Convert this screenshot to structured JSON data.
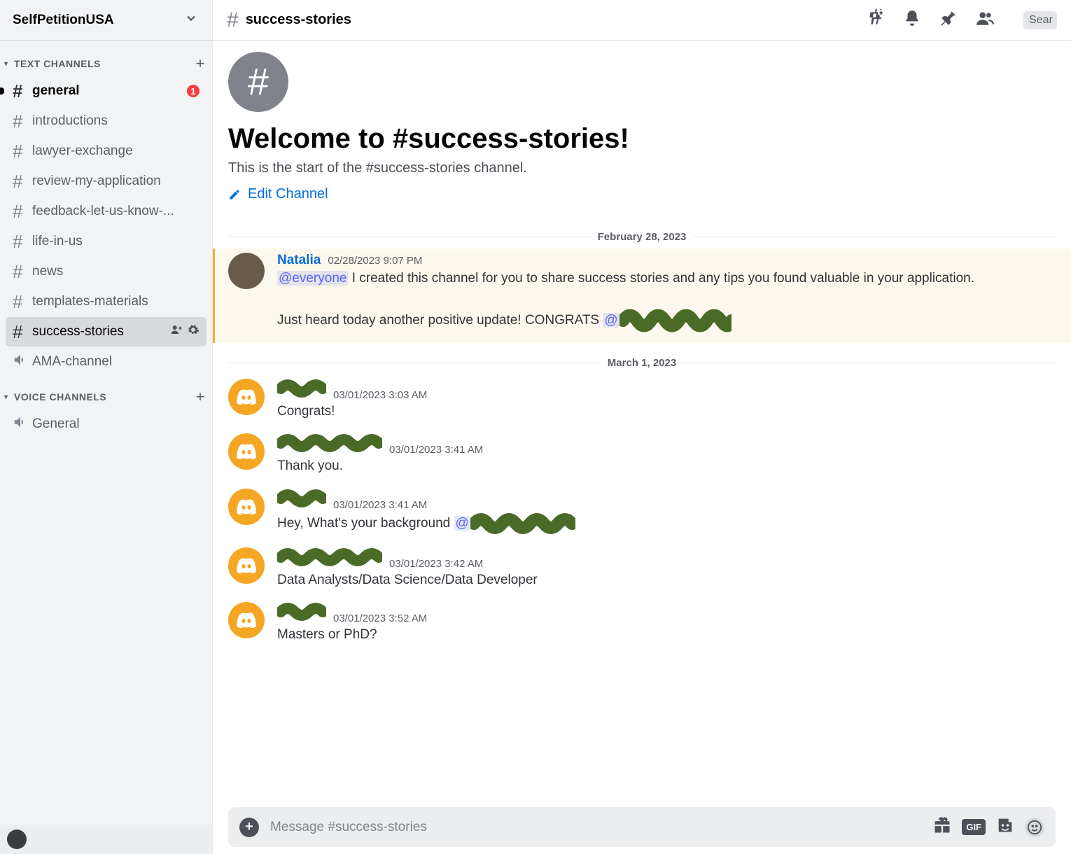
{
  "server": {
    "name": "SelfPetitionUSA"
  },
  "categories": {
    "text": {
      "label": "TEXT CHANNELS"
    },
    "voice": {
      "label": "VOICE CHANNELS"
    }
  },
  "textChannels": [
    {
      "name": "general",
      "unread": true,
      "badge": "1"
    },
    {
      "name": "introductions"
    },
    {
      "name": "lawyer-exchange"
    },
    {
      "name": "review-my-application"
    },
    {
      "name": "feedback-let-us-know-..."
    },
    {
      "name": "life-in-us"
    },
    {
      "name": "news"
    },
    {
      "name": "templates-materials"
    },
    {
      "name": "success-stories",
      "active": true
    }
  ],
  "voiceChannels": [
    {
      "name": "AMA-channel"
    },
    {
      "name": "General"
    }
  ],
  "topbar": {
    "channel": "success-stories",
    "searchPlaceholder": "Sear"
  },
  "welcome": {
    "title": "Welcome to #success-stories!",
    "sub": "This is the start of the #success-stories channel.",
    "edit": "Edit Channel"
  },
  "dividers": {
    "d1": "February 28, 2023",
    "d2": "March 1, 2023"
  },
  "messages": {
    "m0": {
      "user": "Natalia",
      "time": "02/28/2023 9:07 PM",
      "mention": "@everyone",
      "text1": " I created this channel for you to share  success stories and any tips you found valuable in your application.",
      "text2": "Just heard today another positive update! CONGRATS ",
      "at": "@"
    },
    "m1": {
      "time": "03/01/2023 3:03 AM",
      "text": "Congrats!"
    },
    "m2": {
      "time": "03/01/2023 3:41 AM",
      "text": "Thank you."
    },
    "m3": {
      "time": "03/01/2023 3:41 AM",
      "text": "Hey, What's your background ",
      "at": "@"
    },
    "m4": {
      "time": "03/01/2023 3:42 AM",
      "text": "Data Analysts/Data Science/Data Developer"
    },
    "m5": {
      "time": "03/01/2023 3:52 AM",
      "text": "Masters or PhD?"
    }
  },
  "composer": {
    "placeholder": "Message #success-stories",
    "gif": "GIF"
  }
}
